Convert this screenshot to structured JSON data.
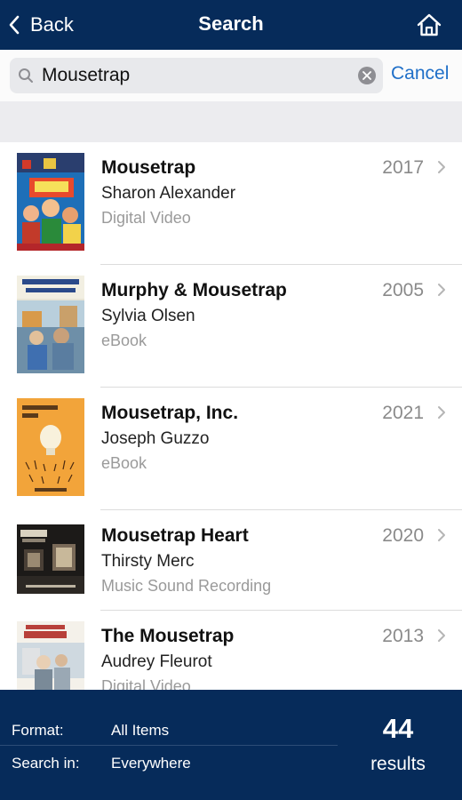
{
  "nav": {
    "back_label": "Back",
    "title": "Search",
    "home_icon": "home-icon"
  },
  "search": {
    "value": "Mousetrap",
    "cancel_label": "Cancel"
  },
  "results": [
    {
      "title": "Mousetrap",
      "author": "Sharon Alexander",
      "format": "Digital Video",
      "year": "2017"
    },
    {
      "title": "Murphy & Mousetrap",
      "author": "Sylvia Olsen",
      "format": "eBook",
      "year": "2005"
    },
    {
      "title": "Mousetrap, Inc.",
      "author": "Joseph Guzzo",
      "format": "eBook",
      "year": "2021"
    },
    {
      "title": "Mousetrap Heart",
      "author": "Thirsty Merc",
      "format": "Music Sound Recording",
      "year": "2020"
    },
    {
      "title": "The Mousetrap",
      "author": "Audrey Fleurot",
      "format": "Digital Video",
      "year": "2013"
    }
  ],
  "footer": {
    "format_label": "Format:",
    "format_value": "All Items",
    "search_in_label": "Search in:",
    "search_in_value": "Everywhere",
    "count": "44",
    "results_label": "results"
  },
  "colors": {
    "nav_bg": "#062b5a",
    "accent": "#1f6fc8"
  }
}
